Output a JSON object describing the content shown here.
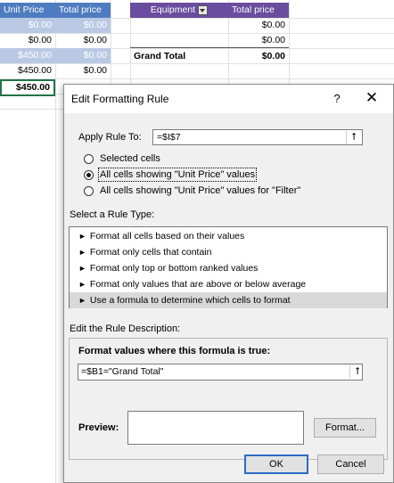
{
  "sheet": {
    "headers": {
      "unit_price": "Unit Price",
      "total_price": "Total price",
      "equipment": "Equipment",
      "total_price_2": "Total price"
    },
    "rows": [
      [
        "$0.00",
        "$0.00"
      ],
      [
        "$0.00",
        "$0.00"
      ],
      [
        "$450.00",
        "$0.00"
      ],
      [
        "$450.00",
        "$0.00"
      ]
    ],
    "active_cell_value": "$450.00",
    "pivot_values": [
      "$0.00",
      "$0.00"
    ],
    "grand_total_label": "Grand Total",
    "grand_total_value": "$0.00",
    "colors": {
      "header_blue": "#4f7cc0",
      "header_purple": "#6a4d9e",
      "selected_row": "#b9c9e4"
    }
  },
  "dialog": {
    "title": "Edit Formatting Rule",
    "help_label": "?",
    "close_label": "✕",
    "apply_rule_to_label": "Apply Rule To:",
    "apply_rule_to_value": "=$I$7",
    "scope_options": [
      {
        "label": "Selected cells",
        "checked": false
      },
      {
        "label": "All cells showing \"Unit Price\" values",
        "checked": true
      },
      {
        "label": "All cells showing \"Unit Price\" values for \"Filter\"",
        "checked": false
      }
    ],
    "rule_type_label": "Select a Rule Type:",
    "rule_types": [
      "Format all cells based on their values",
      "Format only cells that contain",
      "Format only top or bottom ranked values",
      "Format only values that are above or below average",
      "Use a formula to determine which cells to format"
    ],
    "selected_rule_index": 4,
    "description_label": "Edit the Rule Description:",
    "formula_label": "Format values where this formula is true:",
    "formula_value": "=$B1=\"Grand Total\"",
    "preview_label": "Preview:",
    "format_button": "Format...",
    "ok_button": "OK",
    "cancel_button": "Cancel"
  }
}
